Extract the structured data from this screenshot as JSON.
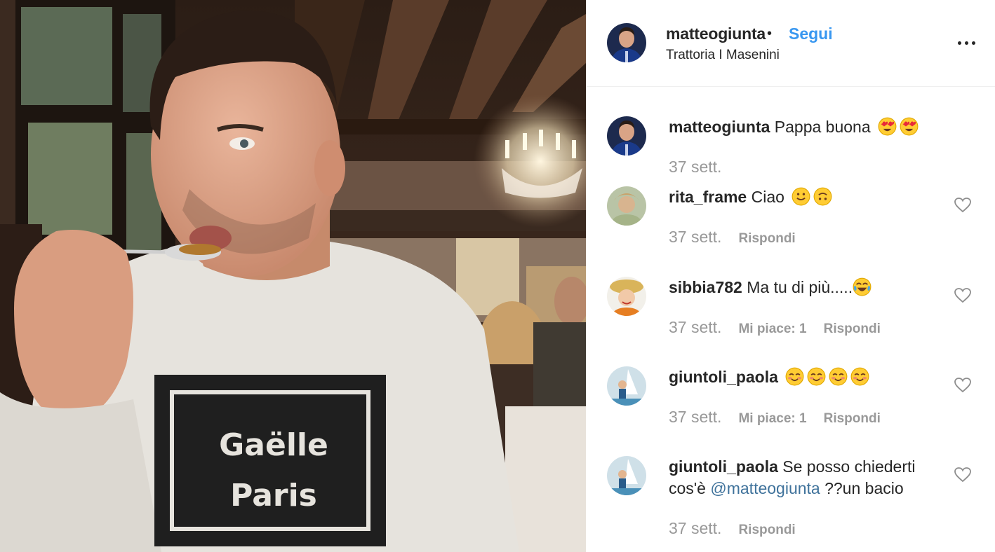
{
  "post": {
    "photo_caption_text": [
      "Gaëlle",
      "Paris"
    ]
  },
  "header": {
    "username": "matteogiunta",
    "separator": "•",
    "follow_label": "Segui",
    "location": "Trattoria I Masenini"
  },
  "comments": [
    {
      "username": "matteogiunta",
      "text": "Pappa buona",
      "emojis": [
        "heart-eyes",
        "heart-eyes"
      ],
      "time": "37 sett.",
      "likes": "",
      "reply_label": "",
      "likeable": false
    },
    {
      "username": "rita_frame",
      "text": "Ciao",
      "emojis": [
        "slight-smile",
        "upside-down"
      ],
      "time": "37 sett.",
      "likes": "",
      "reply_label": "Rispondi",
      "likeable": true
    },
    {
      "username": "sibbia782",
      "text": "Ma tu di più.....",
      "emojis": [
        "tears-of-joy"
      ],
      "time": "37 sett.",
      "likes": "Mi piace: 1",
      "reply_label": "Rispondi",
      "likeable": true
    },
    {
      "username": "giuntoli_paola",
      "text": "",
      "emojis": [
        "blush",
        "blush",
        "blush",
        "blush"
      ],
      "time": "37 sett.",
      "likes": "Mi piace: 1",
      "reply_label": "Rispondi",
      "likeable": true
    },
    {
      "username": "giuntoli_paola",
      "text": "Se posso chiederti cos'è",
      "mention": "@matteogiunta",
      "text_after": "??un bacio",
      "emojis": [],
      "time": "37 sett.",
      "likes": "",
      "reply_label": "Rispondi",
      "likeable": true
    }
  ],
  "colors": {
    "link_blue": "#3897f0",
    "mention_blue": "#3f729b",
    "meta_gray": "#999999",
    "text": "#262626"
  }
}
